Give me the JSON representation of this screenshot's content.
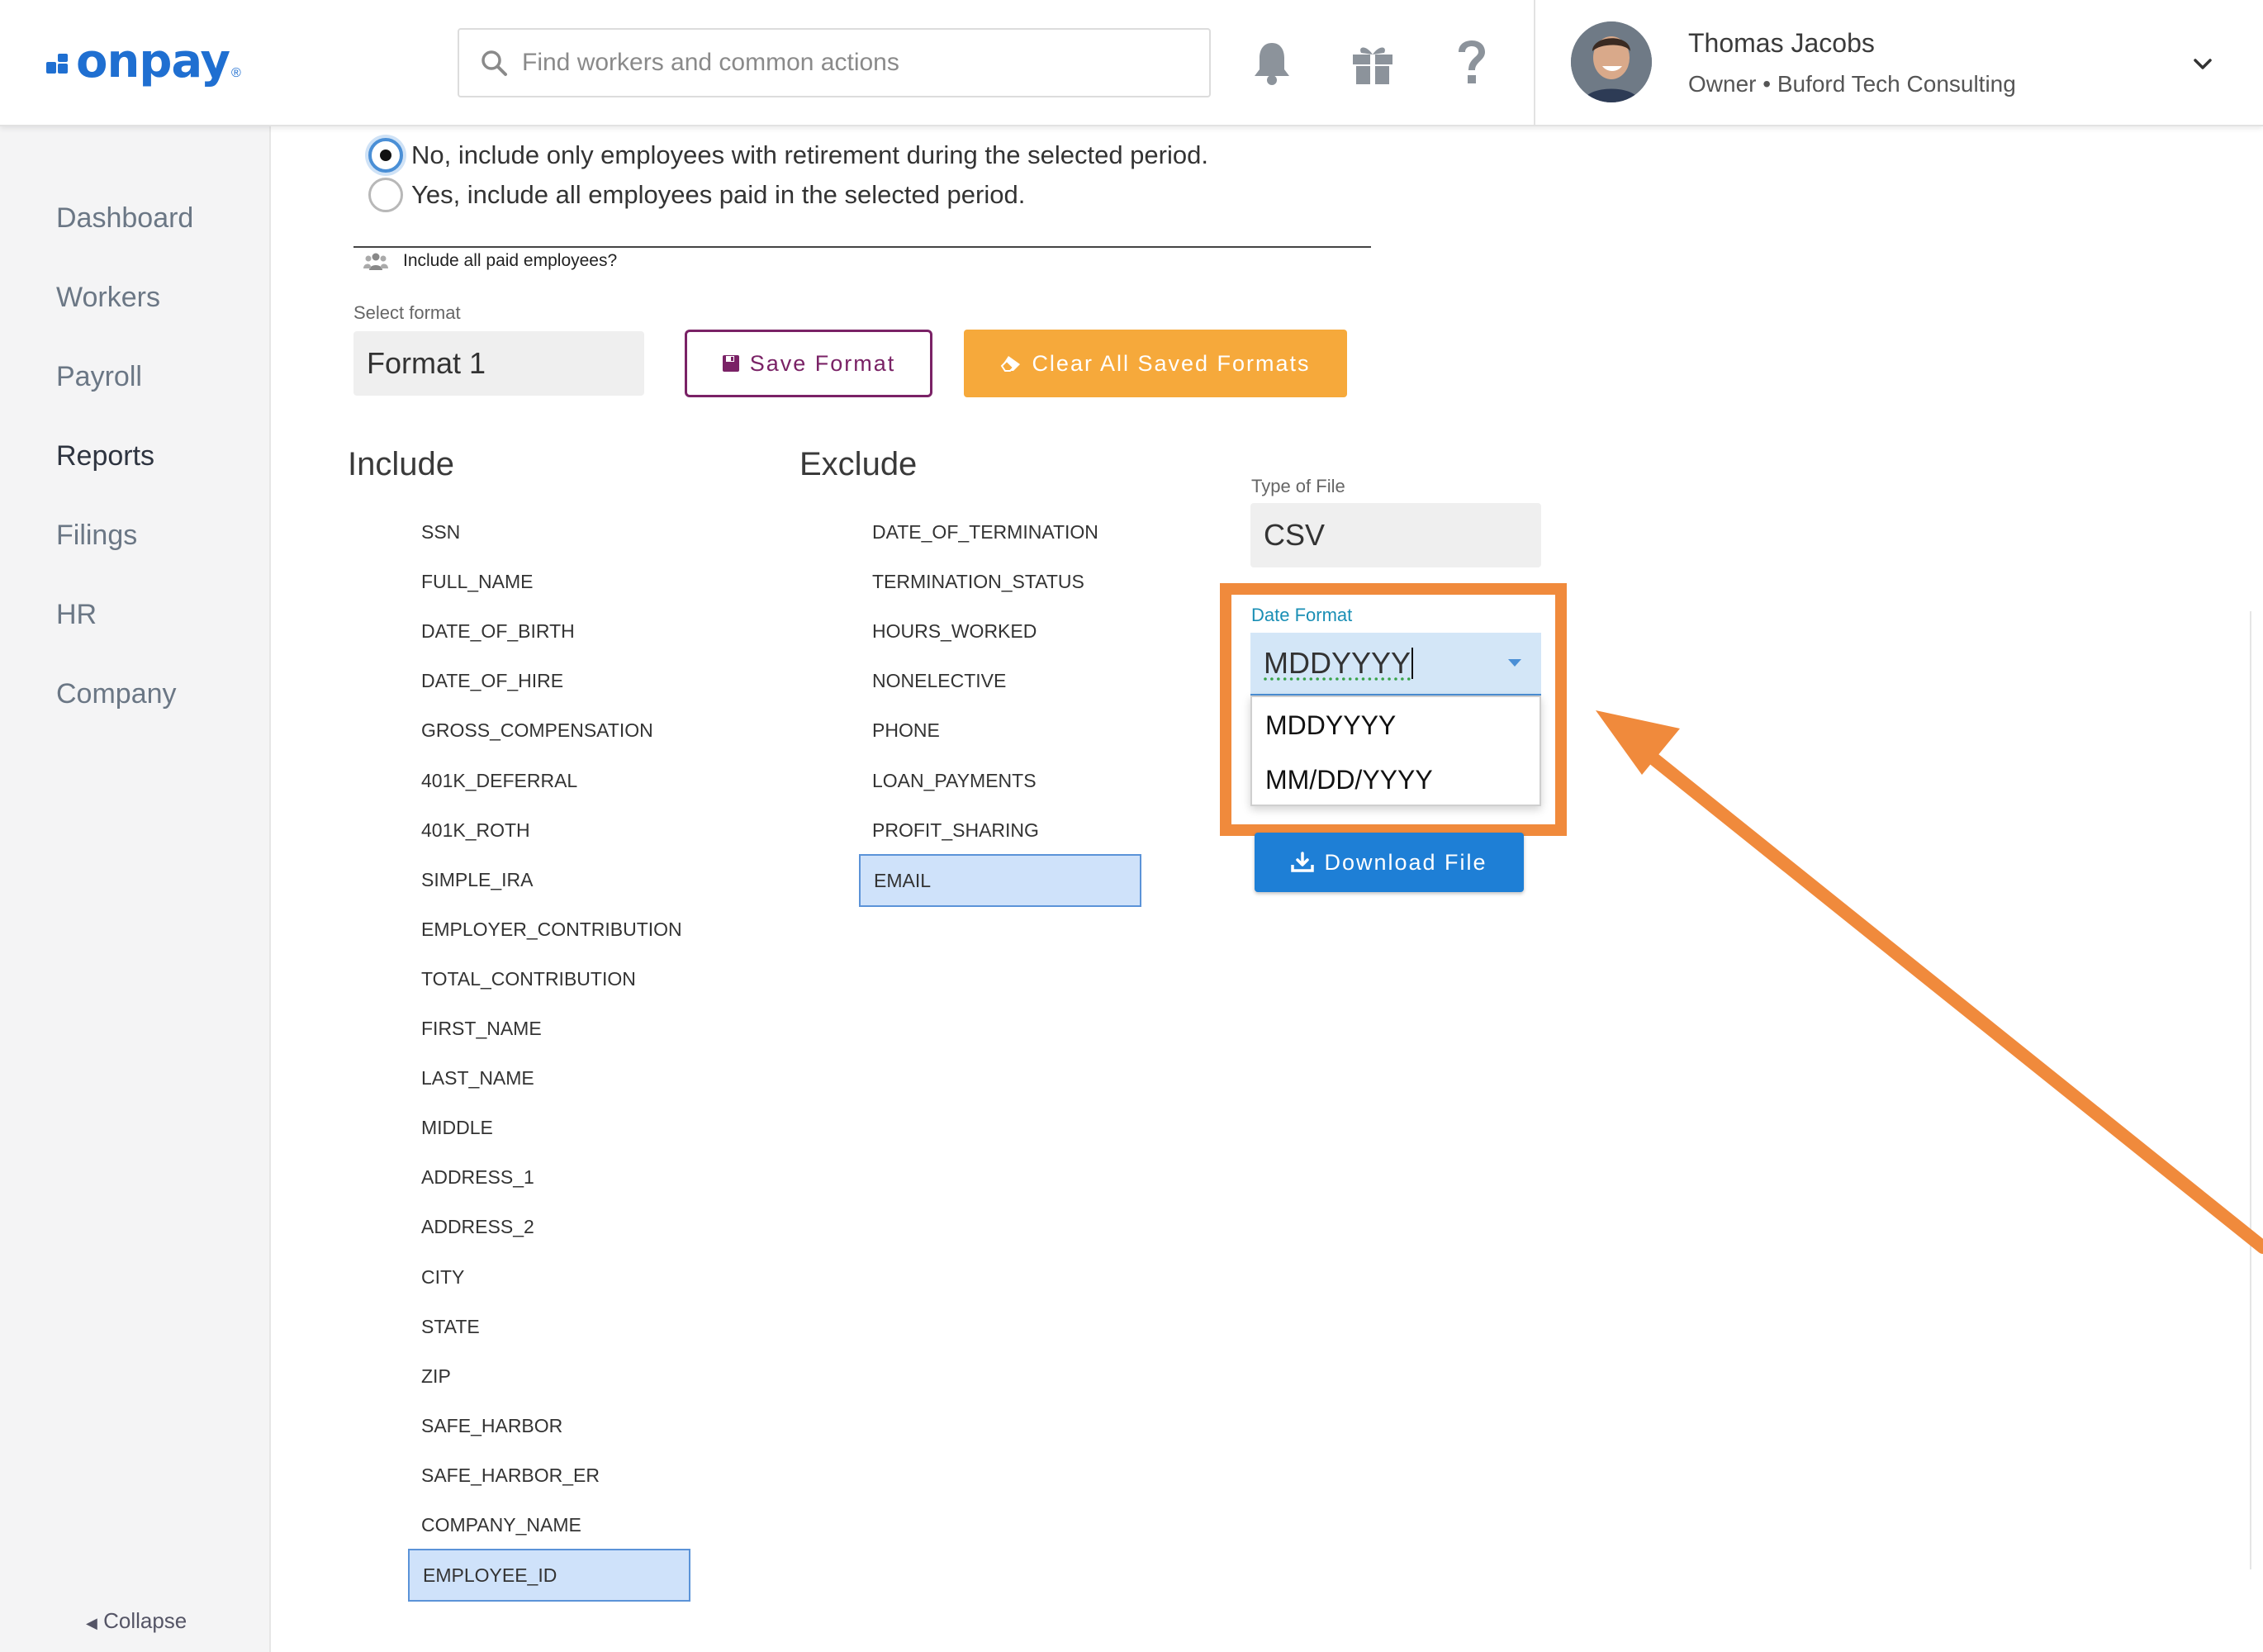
{
  "brand": {
    "logo_text": "onpay",
    "logo_mark": "®",
    "color": "#1f6fd1"
  },
  "header": {
    "search_placeholder": "Find workers and common actions",
    "icons": [
      "bell-icon",
      "gift-icon",
      "help-icon"
    ],
    "user": {
      "name": "Thomas Jacobs",
      "role": "Owner • Buford Tech Consulting"
    }
  },
  "sidebar": {
    "items": [
      {
        "label": "Dashboard",
        "active": false
      },
      {
        "label": "Workers",
        "active": false
      },
      {
        "label": "Payroll",
        "active": false
      },
      {
        "label": "Reports",
        "active": true
      },
      {
        "label": "Filings",
        "active": false
      },
      {
        "label": "HR",
        "active": false
      },
      {
        "label": "Company",
        "active": false
      }
    ],
    "collapse_label": "Collapse"
  },
  "options": {
    "radio_no": "No, include only employees with retirement during the selected period.",
    "radio_yes": "Yes, include all employees paid in the selected period.",
    "selected": "no",
    "hint": "Include all paid employees?"
  },
  "format": {
    "select_label": "Select format",
    "selected_value": "Format 1",
    "save_label": "Save Format",
    "clear_label": "Clear All Saved Formats"
  },
  "include": {
    "title": "Include",
    "fields": [
      "SSN",
      "FULL_NAME",
      "DATE_OF_BIRTH",
      "DATE_OF_HIRE",
      "GROSS_COMPENSATION",
      "401K_DEFERRAL",
      "401K_ROTH",
      "SIMPLE_IRA",
      "EMPLOYER_CONTRIBUTION",
      "TOTAL_CONTRIBUTION",
      "FIRST_NAME",
      "LAST_NAME",
      "MIDDLE",
      "ADDRESS_1",
      "ADDRESS_2",
      "CITY",
      "STATE",
      "ZIP",
      "SAFE_HARBOR",
      "SAFE_HARBOR_ER",
      "COMPANY_NAME",
      "EMPLOYEE_ID"
    ],
    "selected": "EMPLOYEE_ID"
  },
  "exclude": {
    "title": "Exclude",
    "fields": [
      "DATE_OF_TERMINATION",
      "TERMINATION_STATUS",
      "HOURS_WORKED",
      "NONELECTIVE",
      "PHONE",
      "LOAN_PAYMENTS",
      "PROFIT_SHARING",
      "EMAIL"
    ],
    "selected": "EMAIL"
  },
  "file": {
    "type_label": "Type of File",
    "type_value": "CSV",
    "date_label": "Date Format",
    "date_value": "MDDYYYY",
    "date_options": [
      "MDDYYYY",
      "MM/DD/YYYY"
    ],
    "download_label": "Download File"
  },
  "colors": {
    "highlight": "#f08a3c",
    "clear_button": "#f6a93b",
    "save_button": "#7a2266",
    "download_button": "#1e7fd6"
  }
}
